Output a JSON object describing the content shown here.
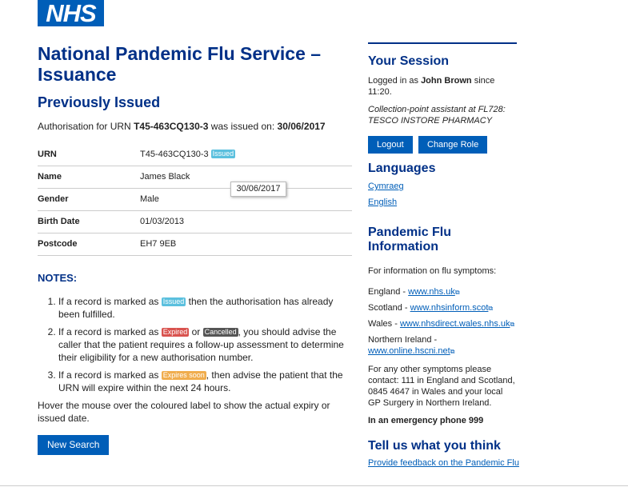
{
  "logo": "NHS",
  "page_title": "National Pandemic Flu Service – Issuance",
  "section_title": "Previously Issued",
  "auth": {
    "prefix": "Authorisation for URN",
    "urn": "T45-463CQ130-3",
    "middle": "was issued on:",
    "date": "30/06/2017"
  },
  "details": [
    {
      "label": "URN",
      "value": "T45-463CQ130-3",
      "badge": "Issued"
    },
    {
      "label": "Name",
      "value": "James Black"
    },
    {
      "label": "Gender",
      "value": "Male"
    },
    {
      "label": "Birth Date",
      "value": "01/03/2013"
    },
    {
      "label": "Postcode",
      "value": "EH7 9EB"
    }
  ],
  "tooltip": "30/06/2017",
  "notes": {
    "title": "NOTES:",
    "item1": {
      "pre": "If a record is marked as",
      "badge": "Issued",
      "post": "then the authorisation has already been fulfilled."
    },
    "item2": {
      "pre": "If a record is marked as",
      "badge1": "Expired",
      "or": "or",
      "badge2": "Cancelled",
      "post": ", you should advise the caller that the patient requires a follow-up assessment to determine their eligibility for a new authorisation number."
    },
    "item3": {
      "pre": "If a record is marked as",
      "badge": "Expires soon",
      "post": ", then advise the patient that the URN will expire within the next 24 hours."
    }
  },
  "hover_note": "Hover the mouse over the coloured label to show the actual expiry or issued date.",
  "new_search": "New Search",
  "session": {
    "title": "Your Session",
    "logged_pre": "Logged in as",
    "user": "John Brown",
    "logged_post": "since 11:20.",
    "role": "Collection-point assistant at FL728: TESCO INSTORE PHARMACY",
    "logout": "Logout",
    "change_role": "Change Role"
  },
  "languages": {
    "title": "Languages",
    "items": [
      "Cymraeg",
      "English"
    ]
  },
  "flu_info": {
    "title": "Pandemic Flu Information",
    "intro": "For information on flu symptoms:",
    "england_label": "England -",
    "england_link": "www.nhs.uk",
    "scotland_label": "Scotland -",
    "scotland_link": "www.nhsinform.scot",
    "wales_label": "Wales -",
    "wales_link": "www.nhsdirect.wales.nhs.uk",
    "ni_label": "Northern Ireland -",
    "ni_link": "www.online.hscni.net",
    "other": "For any other symptoms please contact: 111 in England and Scotland, 0845 4647 in Wales and your local GP Surgery in Northern Ireland.",
    "emergency": "In an emergency phone 999"
  },
  "feedback": {
    "title": "Tell us what you think",
    "link": "Provide feedback on the Pandemic Flu"
  },
  "colors": {
    "nhs_blue": "#005eb8",
    "heading_blue": "#003087"
  }
}
